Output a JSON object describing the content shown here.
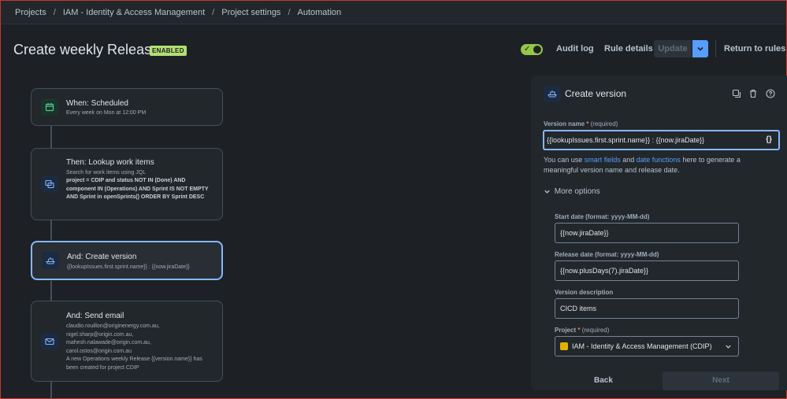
{
  "breadcrumbs": [
    "Projects",
    "IAM - Identity & Access Management",
    "Project settings",
    "Automation"
  ],
  "header": {
    "title": "Create weekly Release",
    "status_badge": "ENABLED",
    "audit_log": "Audit log",
    "rule_details": "Rule details",
    "update": "Update",
    "return_to_rules": "Return to rules"
  },
  "flow": {
    "trigger": {
      "title": "When: Scheduled",
      "subtitle": "Every week on Mon at 12:00 PM"
    },
    "lookup": {
      "title": "Then: Lookup work items",
      "subtitle": "Search for work items using JQL",
      "jql": "project = CDIP and status NOT IN (Done) AND component IN (Operations) AND Sprint IS NOT EMPTY AND Sprint in openSprints() ORDER BY Sprint DESC"
    },
    "create_version": {
      "title": "And: Create version",
      "subtitle": "{{lookupIssues.first.sprint.name}} : {{now.jiraDate}}"
    },
    "send_email": {
      "title": "And: Send email",
      "recipients": [
        "claudio.rouillon@originenergy.com.au,",
        "nigel.sharp@origin.com.au,",
        "mahesh.nalawade@origin.com.au,",
        "carol.ostos@origin.com.au"
      ],
      "body": "A new Operations weekly Release {{version.name}} has been created for project CDIP"
    }
  },
  "panel": {
    "title": "Create version",
    "version_name_label": "Version name",
    "required_marker": "*",
    "required_text": "(required)",
    "version_name_value": "{{lookupIssues.first.sprint.name}} : {{now.jiraDate}}",
    "smart_value_button": "{}",
    "help_prefix": "You can use ",
    "help_link1": "smart fields",
    "help_and": " and ",
    "help_link2": "date functions",
    "help_suffix": " here to generate a meaningful version name and release date.",
    "more_options": "More options",
    "start_date_label": "Start date (format: yyyy-MM-dd)",
    "start_date_value": "{{now.jiraDate}}",
    "release_date_label": "Release date (format: yyyy-MM-dd)",
    "release_date_value": "{{now.plusDays(7).jiraDate}}",
    "version_description_label": "Version description",
    "version_description_value": "CICD items",
    "project_label": "Project",
    "project_value": "IAM - Identity & Access Management (CDIP)",
    "back": "Back",
    "next": "Next"
  },
  "colors": {
    "accent": "#579dff",
    "enabled_badge": "#b3df72",
    "toggle_on": "#94c748",
    "required": "#f87168"
  },
  "icons": [
    "calendar-icon",
    "lookup-icon",
    "version-boat-icon",
    "mail-icon",
    "duplicate-icon",
    "trash-icon",
    "help-icon",
    "chevron-down-icon"
  ]
}
